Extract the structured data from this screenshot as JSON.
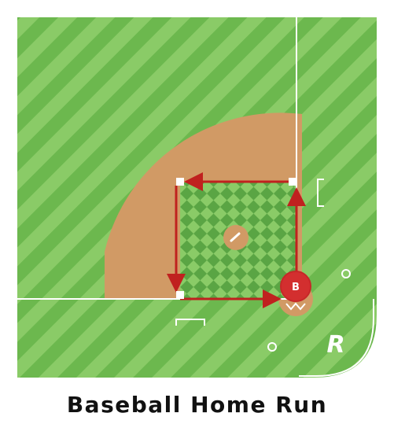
{
  "title": "Baseball Home Run",
  "runner": {
    "label": "B"
  },
  "logo": {
    "text": "R"
  },
  "colors": {
    "grass_dark": "#6cb84e",
    "grass_light": "#8acb67",
    "dirt": "#d19a65",
    "chalk": "#ffffff",
    "arrow": "#c0211f",
    "runner_fill": "#d32f2f",
    "caption": "#111111"
  },
  "path": [
    "home",
    "first",
    "second",
    "third",
    "home"
  ],
  "bases": [
    "home",
    "first",
    "second",
    "third"
  ]
}
